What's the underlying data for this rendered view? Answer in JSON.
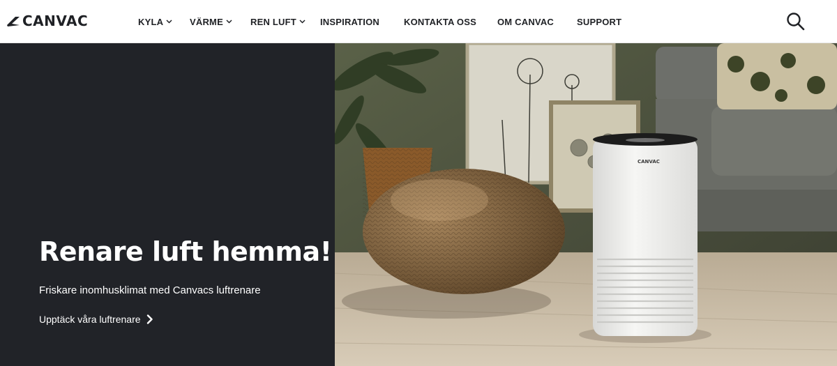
{
  "brand": {
    "name": "CANVAC",
    "icon": "canvac-logo-mark"
  },
  "nav": {
    "items": [
      {
        "label": "KYLA",
        "has_dropdown": true
      },
      {
        "label": "VÄRME",
        "has_dropdown": true
      },
      {
        "label": "REN LUFT",
        "has_dropdown": true
      },
      {
        "label": "INSPIRATION",
        "has_dropdown": false
      },
      {
        "label": "KONTAKTA OSS",
        "has_dropdown": false
      },
      {
        "label": "OM CANVAC",
        "has_dropdown": false
      },
      {
        "label": "SUPPORT",
        "has_dropdown": false
      }
    ],
    "search_icon": "search-icon"
  },
  "hero": {
    "title": "Renare luft hemma!",
    "subtitle": "Friskare inomhusklimat med Canvacs luftrenare",
    "cta_label": "Upptäck våra luftrenare",
    "cta_icon": "chevron-right-icon",
    "product_brand_label": "CANVAC"
  },
  "colors": {
    "panel": "#212328",
    "text_on_panel": "#ffffff",
    "header_bg": "#ffffff",
    "nav_text": "#1f2125"
  }
}
